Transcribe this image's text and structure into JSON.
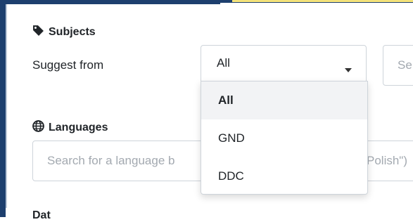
{
  "subjects": {
    "heading": "Subjects",
    "icon": "tag-icon",
    "suggest_label": "Suggest from",
    "selected_value": "All",
    "options": [
      "All",
      "GND",
      "DDC"
    ],
    "side_input_placeholder": "Se"
  },
  "languages": {
    "heading": "Languages",
    "icon": "globe-icon",
    "placeholder_left": "Search for a language b",
    "placeholder_right": "Polish\")"
  },
  "next_section": {
    "heading": "Dat"
  },
  "colors": {
    "frame": "#1d3f6e",
    "selected_bg": "#f2f3f5",
    "border": "#ced4da"
  }
}
